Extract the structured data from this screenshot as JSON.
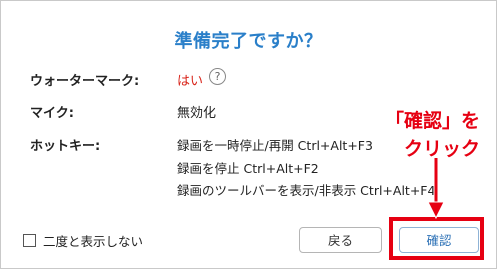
{
  "dialog": {
    "title": "準備完了ですか？",
    "rows": {
      "watermark": {
        "label": "ウォーターマーク:",
        "value": "はい",
        "help_icon": "question-circle-icon"
      },
      "mic": {
        "label": "マイク:",
        "value": "無効化"
      },
      "hotkeys": {
        "label": "ホットキー:",
        "lines": [
          "録画を一時停止/再開 Ctrl+Alt+F3",
          "録画を停止 Ctrl+Alt+F2",
          "録画のツールバーを表示/非表示 Ctrl+Alt+F4"
        ]
      }
    },
    "footer": {
      "dont_show_label": "二度と表示しない",
      "back_label": "戻る",
      "confirm_label": "確認"
    }
  },
  "annotation": {
    "line1": "「確認」を",
    "line2": "クリック",
    "color": "#e60012"
  },
  "colors": {
    "title": "#2a7fc9",
    "value_red": "#d9261c"
  }
}
